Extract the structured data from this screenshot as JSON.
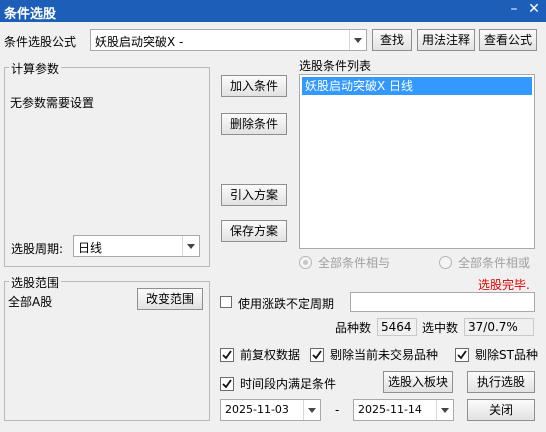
{
  "window": {
    "title": "条件选股",
    "minimize_glyph": "–",
    "close_glyph": "✕"
  },
  "formula": {
    "label": "条件选股公式",
    "selected": "妖股启动突破X  -",
    "find_button": "查找",
    "usage_button": "用法注释",
    "view_button": "查看公式"
  },
  "params": {
    "title": "计算参数",
    "empty_text": "无参数需要设置",
    "period_label": "选股周期:",
    "period_value": "日线"
  },
  "actions": {
    "add_condition": "加入条件",
    "delete_condition": "删除条件",
    "import_plan": "引入方案",
    "save_plan": "保存方案"
  },
  "condition_list": {
    "title": "选股条件列表",
    "items": [
      "妖股启动突破X  日线"
    ]
  },
  "logic": {
    "and_label": "全部条件相与",
    "or_label": "全部条件相或"
  },
  "status": {
    "text": "选股完毕.",
    "color": "#e00000"
  },
  "range": {
    "title": "选股范围",
    "value": "全部A股",
    "change_button": "改变范围"
  },
  "change_period": {
    "label": "使用涨跌不定周期",
    "checked": false,
    "value": ""
  },
  "stats": {
    "count_label": "品种数",
    "count_value": "5464",
    "selected_label": "选中数",
    "selected_value": "37/0.7%"
  },
  "options": {
    "forward_adjust": {
      "label": "前复权数据",
      "checked": true
    },
    "exclude_untraded": {
      "label": "剔除当前未交易品种",
      "checked": true
    },
    "exclude_st": {
      "label": "剔除ST品种",
      "checked": true
    },
    "time_range": {
      "label": "时间段内满足条件",
      "checked": true
    }
  },
  "bottom": {
    "to_block_button": "选股入板块",
    "execute_button": "执行选股",
    "close_button": "关闭",
    "start_date": "2025-11-03",
    "dash": "-",
    "end_date": "2025-11-14"
  },
  "colors": {
    "title_bar": "#1d5fb8",
    "selection": "#3399ff",
    "status": "#e00000"
  }
}
